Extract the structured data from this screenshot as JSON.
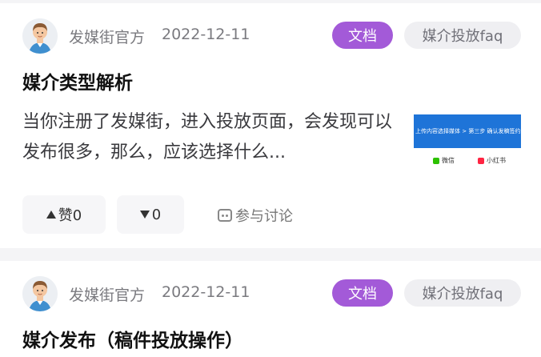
{
  "posts": [
    {
      "author": "发媒街官方",
      "date": "2022-12-11",
      "tag_type": "文档",
      "tag_category": "媒介投放faq",
      "title": "媒介类型解析",
      "excerpt": "当你注册了发媒街，进入投放页面，会发现可以发布很多，那么，应该选择什么...",
      "thumbnail": {
        "banner_text": "上传内容选择媒体 > 第三步 确认发稿签约信息",
        "wechat_label": "微信",
        "xiaohongshu_label": "小红书"
      },
      "like_label": "赞0",
      "dislike_label": "0",
      "discuss_label": "参与讨论"
    },
    {
      "author": "发媒街官方",
      "date": "2022-12-11",
      "tag_type": "文档",
      "tag_category": "媒介投放faq",
      "title": "媒介发布（稿件投放操作）"
    }
  ],
  "colors": {
    "tag_doc_bg": "#a35ad8",
    "thumb_banner": "#1e74d8",
    "wechat_green": "#2dc100",
    "xhs_red": "#ff2442"
  }
}
